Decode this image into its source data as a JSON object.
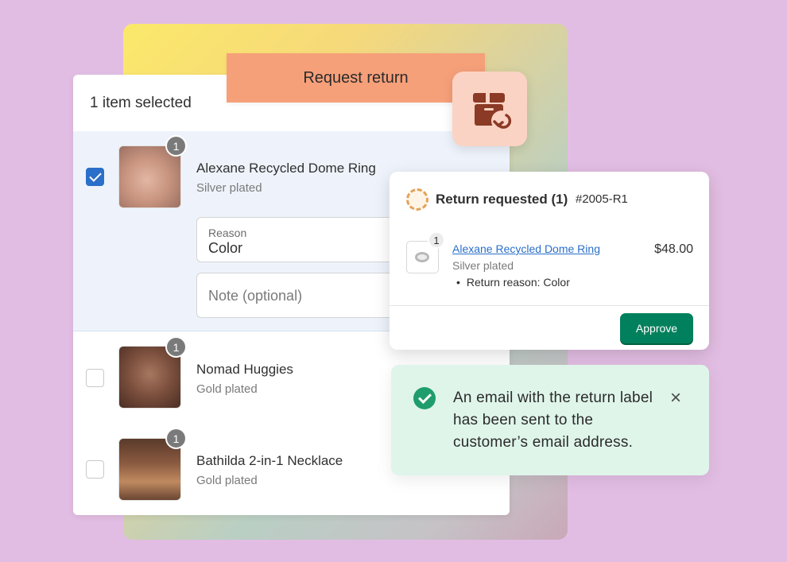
{
  "header": {
    "selection_count": "1 item selected"
  },
  "banner": {
    "title": "Request return"
  },
  "items": [
    {
      "name": "Alexane Recycled Dome Ring",
      "variant": "Silver plated",
      "qty": "1",
      "checked": true
    },
    {
      "name": "Nomad Huggies",
      "variant": "Gold plated",
      "qty": "1",
      "checked": false
    },
    {
      "name": "Bathilda 2-in-1 Necklace",
      "variant": "Gold plated",
      "qty": "1",
      "checked": false
    }
  ],
  "form": {
    "reason_label": "Reason",
    "reason_value": "Color",
    "note_placeholder": "Note (optional)"
  },
  "return_card": {
    "title": "Return requested (1)",
    "order": "#2005-R1",
    "product_name": "Alexane Recycled Dome Ring",
    "product_variant": "Silver plated",
    "product_qty": "1",
    "reason": "Return reason: Color",
    "price": "$48.00",
    "approve_label": "Approve"
  },
  "toast": {
    "message": "An email with the return label has been sent to the customer’s email address.",
    "close_icon": "×"
  },
  "colors": {
    "background": "#e2bde3",
    "accent_blue": "#2a6fc9",
    "approve_green": "#00805c",
    "banner_orange": "#f6a07a",
    "toast_bg": "#dff5ea"
  },
  "icons": {
    "return_badge": "box-return-icon",
    "status": "return-status-icon",
    "success": "checkmark-circle-icon"
  }
}
